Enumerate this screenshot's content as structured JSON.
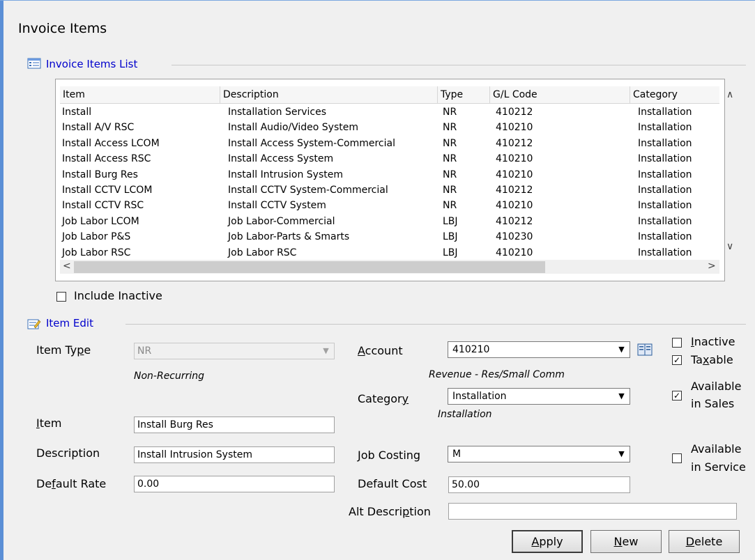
{
  "page": {
    "title": "Invoice Items"
  },
  "list_section": {
    "title": "Invoice Items List",
    "icon": "list-icon"
  },
  "list": {
    "columns": [
      "Item",
      "Description",
      "Type",
      "G/L Code",
      "Category"
    ],
    "rows": [
      [
        "Install",
        "Installation Services",
        "NR",
        "410212",
        "Installation"
      ],
      [
        "Install A/V RSC",
        "Install Audio/Video System",
        "NR",
        "410210",
        "Installation"
      ],
      [
        "Install Access LCOM",
        "Install Access System-Commercial",
        "NR",
        "410212",
        "Installation"
      ],
      [
        "Install Access RSC",
        "Install Access System",
        "NR",
        "410210",
        "Installation"
      ],
      [
        "Install Burg Res",
        "Install Intrusion System",
        "NR",
        "410210",
        "Installation"
      ],
      [
        "Install CCTV LCOM",
        "Install CCTV System-Commercial",
        "NR",
        "410212",
        "Installation"
      ],
      [
        "Install CCTV RSC",
        "Install CCTV System",
        "NR",
        "410210",
        "Installation"
      ],
      [
        "Job Labor LCOM",
        "Job Labor-Commercial",
        "LBJ",
        "410212",
        "Installation"
      ],
      [
        "Job Labor P&S",
        "Job Labor-Parts & Smarts",
        "LBJ",
        "410230",
        "Installation"
      ],
      [
        "Job Labor RSC",
        "Job Labor RSC",
        "LBJ",
        "410210",
        "Installation"
      ]
    ]
  },
  "include_inactive": {
    "label": "Include Inactive",
    "checked": false
  },
  "edit_section": {
    "title": "Item Edit",
    "icon": "edit-icon"
  },
  "form": {
    "item_type": {
      "label": "Item Type",
      "value": "NR",
      "caption": "Non-Recurring"
    },
    "item": {
      "label": "Item",
      "value": "Install Burg Res"
    },
    "description": {
      "label": "Description",
      "value": "Install Intrusion System"
    },
    "default_rate": {
      "label": "Default Rate",
      "value": "0.00"
    },
    "account": {
      "label": "Account",
      "value": "410210",
      "caption": "Revenue - Res/Small Comm"
    },
    "category": {
      "label": "Category",
      "value": "Installation",
      "caption": "Installation"
    },
    "job_costing": {
      "label": "Job Costing",
      "value": "M"
    },
    "default_cost": {
      "label": "Default Cost",
      "value": "50.00"
    },
    "alt_description": {
      "label": "Alt Description",
      "value": ""
    }
  },
  "flags": {
    "inactive": {
      "label": "Inactive",
      "checked": false
    },
    "taxable": {
      "label": "Taxable",
      "checked": true
    },
    "available_sales": {
      "line1": "Available",
      "line2": "in Sales",
      "checked": true
    },
    "available_service": {
      "line1": "Available",
      "line2": "in Service",
      "checked": false
    }
  },
  "buttons": {
    "apply": "Apply",
    "new": "New",
    "delete": "Delete"
  }
}
